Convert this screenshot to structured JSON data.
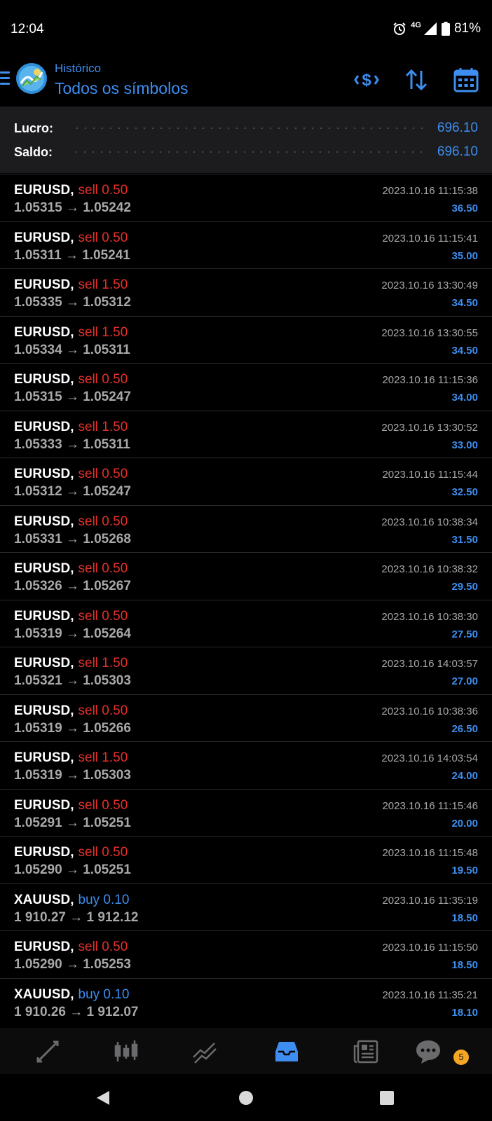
{
  "status": {
    "time": "12:04",
    "network": "4G",
    "battery": "81%"
  },
  "header": {
    "subtitle": "Histórico",
    "title": "Todos os símbolos"
  },
  "summary": {
    "profit_label": "Lucro:",
    "profit_value": "696.10",
    "balance_label": "Saldo:",
    "balance_value": "696.10"
  },
  "deals": [
    {
      "symbol": "EURUSD,",
      "side": "sell",
      "volume": "sell 0.50",
      "prices": "1.05315 → 1.05242",
      "time": "2023.10.16 11:15:38",
      "profit": "36.50"
    },
    {
      "symbol": "EURUSD,",
      "side": "sell",
      "volume": "sell 0.50",
      "prices": "1.05311 → 1.05241",
      "time": "2023.10.16 11:15:41",
      "profit": "35.00"
    },
    {
      "symbol": "EURUSD,",
      "side": "sell",
      "volume": "sell 1.50",
      "prices": "1.05335 → 1.05312",
      "time": "2023.10.16 13:30:49",
      "profit": "34.50"
    },
    {
      "symbol": "EURUSD,",
      "side": "sell",
      "volume": "sell 1.50",
      "prices": "1.05334 → 1.05311",
      "time": "2023.10.16 13:30:55",
      "profit": "34.50"
    },
    {
      "symbol": "EURUSD,",
      "side": "sell",
      "volume": "sell 0.50",
      "prices": "1.05315 → 1.05247",
      "time": "2023.10.16 11:15:36",
      "profit": "34.00"
    },
    {
      "symbol": "EURUSD,",
      "side": "sell",
      "volume": "sell 1.50",
      "prices": "1.05333 → 1.05311",
      "time": "2023.10.16 13:30:52",
      "profit": "33.00"
    },
    {
      "symbol": "EURUSD,",
      "side": "sell",
      "volume": "sell 0.50",
      "prices": "1.05312 → 1.05247",
      "time": "2023.10.16 11:15:44",
      "profit": "32.50"
    },
    {
      "symbol": "EURUSD,",
      "side": "sell",
      "volume": "sell 0.50",
      "prices": "1.05331 → 1.05268",
      "time": "2023.10.16 10:38:34",
      "profit": "31.50"
    },
    {
      "symbol": "EURUSD,",
      "side": "sell",
      "volume": "sell 0.50",
      "prices": "1.05326 → 1.05267",
      "time": "2023.10.16 10:38:32",
      "profit": "29.50"
    },
    {
      "symbol": "EURUSD,",
      "side": "sell",
      "volume": "sell 0.50",
      "prices": "1.05319 → 1.05264",
      "time": "2023.10.16 10:38:30",
      "profit": "27.50"
    },
    {
      "symbol": "EURUSD,",
      "side": "sell",
      "volume": "sell 1.50",
      "prices": "1.05321 → 1.05303",
      "time": "2023.10.16 14:03:57",
      "profit": "27.00"
    },
    {
      "symbol": "EURUSD,",
      "side": "sell",
      "volume": "sell 0.50",
      "prices": "1.05319 → 1.05266",
      "time": "2023.10.16 10:38:36",
      "profit": "26.50"
    },
    {
      "symbol": "EURUSD,",
      "side": "sell",
      "volume": "sell 1.50",
      "prices": "1.05319 → 1.05303",
      "time": "2023.10.16 14:03:54",
      "profit": "24.00"
    },
    {
      "symbol": "EURUSD,",
      "side": "sell",
      "volume": "sell 0.50",
      "prices": "1.05291 → 1.05251",
      "time": "2023.10.16 11:15:46",
      "profit": "20.00"
    },
    {
      "symbol": "EURUSD,",
      "side": "sell",
      "volume": "sell 0.50",
      "prices": "1.05290 → 1.05251",
      "time": "2023.10.16 11:15:48",
      "profit": "19.50"
    },
    {
      "symbol": "XAUUSD,",
      "side": "buy",
      "volume": "buy 0.10",
      "prices": "1 910.27 → 1 912.12",
      "time": "2023.10.16 11:35:19",
      "profit": "18.50"
    },
    {
      "symbol": "EURUSD,",
      "side": "sell",
      "volume": "sell 0.50",
      "prices": "1.05290 → 1.05253",
      "time": "2023.10.16 11:15:50",
      "profit": "18.50"
    },
    {
      "symbol": "XAUUSD,",
      "side": "buy",
      "volume": "buy 0.10",
      "prices": "1 910.26 → 1 912.07",
      "time": "2023.10.16 11:35:21",
      "profit": "18.10"
    }
  ],
  "bottom_nav": {
    "items": [
      {
        "icon": "quotes-icon"
      },
      {
        "icon": "chart-icon"
      },
      {
        "icon": "trade-icon"
      },
      {
        "icon": "history-icon",
        "active": true
      },
      {
        "icon": "news-icon"
      },
      {
        "icon": "chat-icon"
      }
    ],
    "chat_badge": "5"
  },
  "colors": {
    "accent": "#3d8ef0",
    "sell": "#e3302a",
    "muted": "#a8a8aa",
    "badge": "#f5a623",
    "background": "#000000"
  }
}
